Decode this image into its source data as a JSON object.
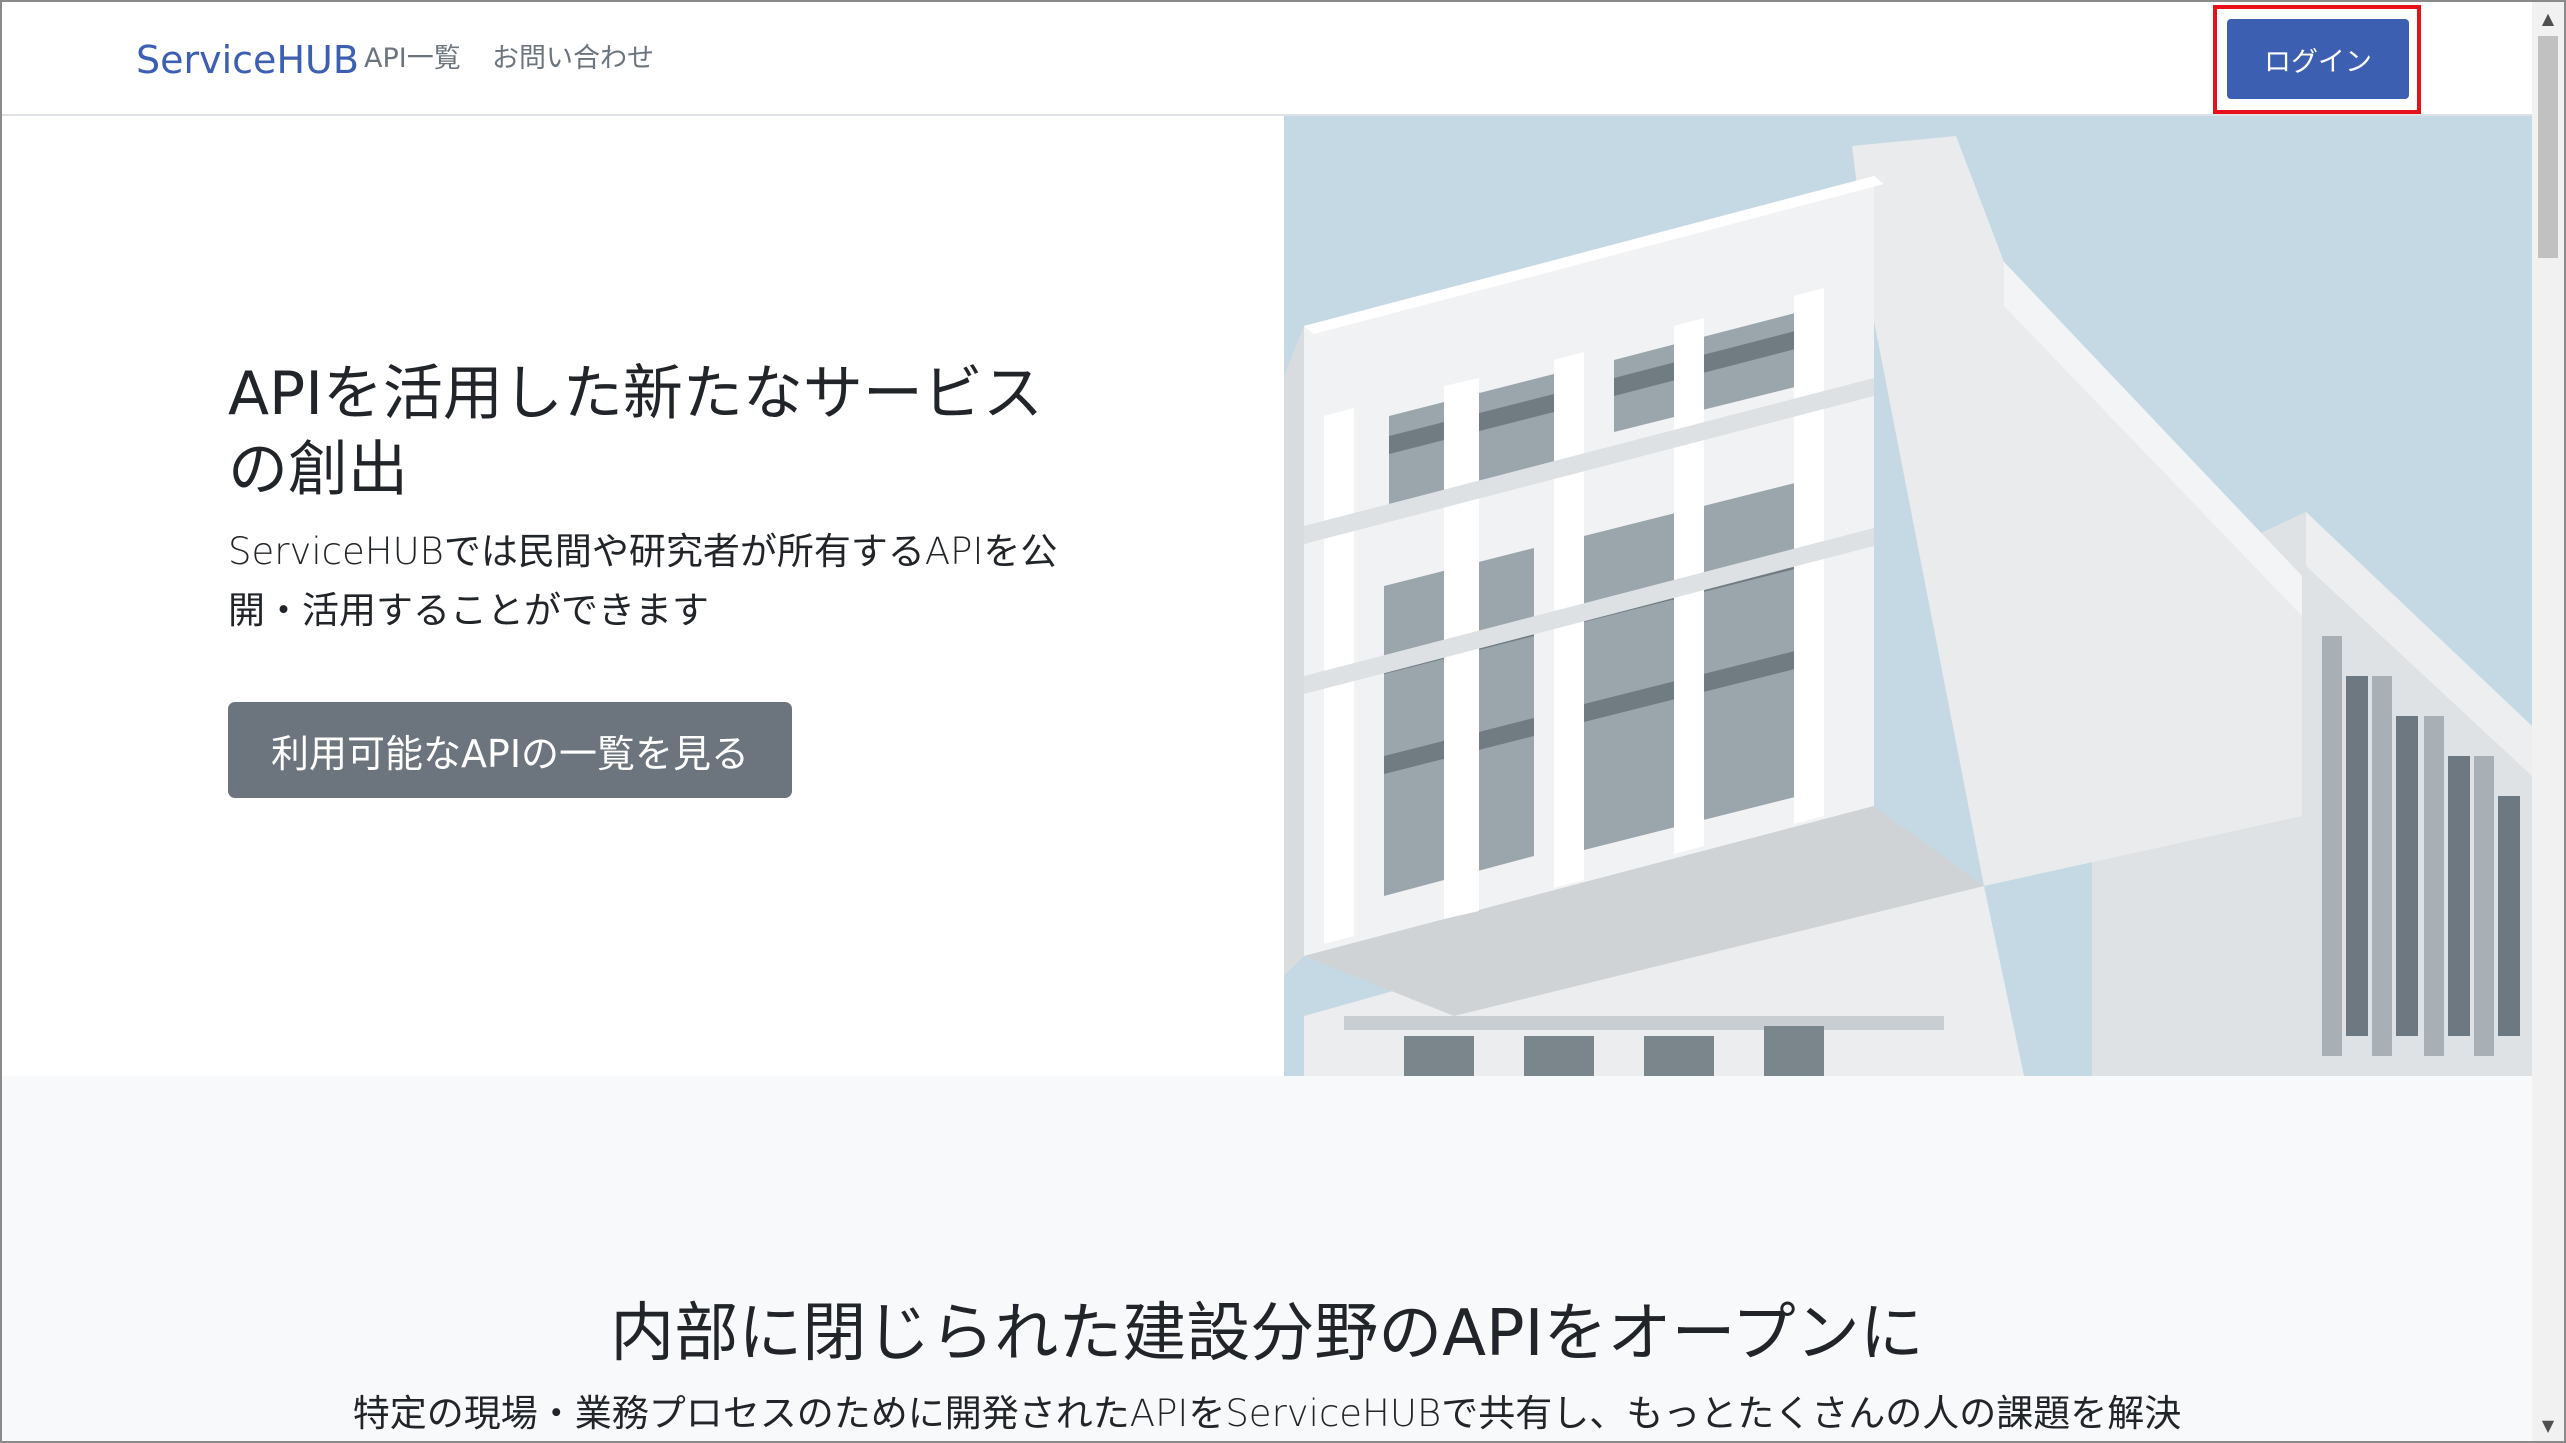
{
  "navbar": {
    "brand": "ServiceHUB",
    "links": [
      "API一覧",
      "お問い合わせ"
    ],
    "login_label": "ログイン"
  },
  "hero": {
    "title": "APIを活用した新たなサービスの創出",
    "lead": "ServiceHUBでは民間や研究者が所有するAPIを公開・活用することができます",
    "cta_label": "利用可能なAPIの一覧を見る",
    "image_name": "modern-white-building-photo"
  },
  "section2": {
    "title": "内部に閉じられた建設分野のAPIをオープンに",
    "subtitle": "特定の現場・業務プロセスのために開発されたAPIをServiceHUBで共有し、もっとたくさんの人の課題を解決"
  },
  "colors": {
    "brand": "#3d5fb1",
    "secondary_button": "#6c757d",
    "highlight": "#e8101a",
    "section_bg": "#f8f9fa",
    "sky": "#c5d9e4"
  },
  "scrollbar": {
    "up_icon": "triangle-up-icon",
    "down_icon": "triangle-down-icon"
  }
}
